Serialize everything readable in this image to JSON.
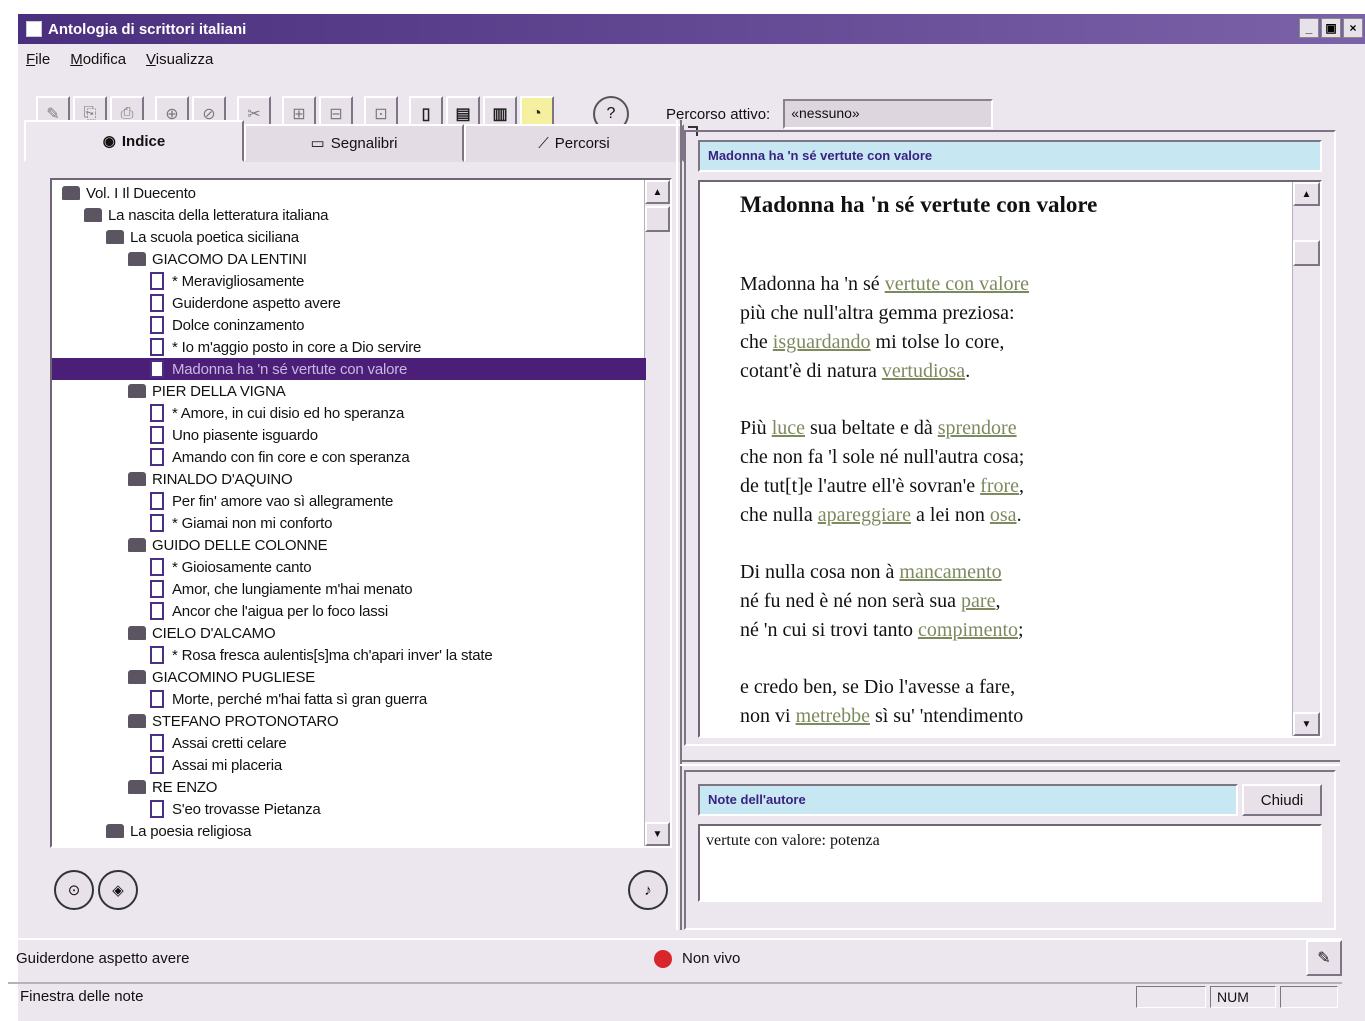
{
  "window": {
    "title": "Antologia di scrittori italiani",
    "buttons": [
      "_",
      "▣",
      "×"
    ]
  },
  "menu": [
    "File",
    "Modifica",
    "Visualizza"
  ],
  "toolbar": {
    "buttons": [
      "✎",
      "⎘",
      "⎙",
      "⊕",
      "⊘",
      "✂",
      "⊞",
      "⊟",
      "⊡",
      "⊠",
      "▯",
      "▤",
      "▥",
      "◔"
    ],
    "path_label": "Percorso attivo:",
    "path_value": "«nessuno»"
  },
  "tabs": [
    {
      "label": "Indice",
      "icon": "index-icon"
    },
    {
      "label": "Segnalibri",
      "icon": "bookmark-icon"
    },
    {
      "label": "Percorsi",
      "icon": "path-icon"
    }
  ],
  "tree": [
    {
      "label": "Vol. I Il Duecento",
      "level": 0,
      "type": "book"
    },
    {
      "label": "La nascita della letteratura italiana",
      "level": 1,
      "type": "book"
    },
    {
      "label": "La scuola poetica siciliana",
      "level": 2,
      "type": "book"
    },
    {
      "label": "GIACOMO DA LENTINI",
      "level": 3,
      "type": "book"
    },
    {
      "label": "* Meravigliosamente",
      "level": 4,
      "type": "doc"
    },
    {
      "label": "Guiderdone aspetto avere",
      "level": 4,
      "type": "doc"
    },
    {
      "label": "Dolce coninzamento",
      "level": 4,
      "type": "doc"
    },
    {
      "label": "* Io m'aggio posto in core a Dio servire",
      "level": 4,
      "type": "doc"
    },
    {
      "label": "Madonna ha 'n sé vertute con valore",
      "level": 4,
      "type": "doc",
      "selected": true
    },
    {
      "label": "PIER DELLA VIGNA",
      "level": 3,
      "type": "book"
    },
    {
      "label": "* Amore, in cui disio ed ho speranza",
      "level": 4,
      "type": "doc"
    },
    {
      "label": "Uno piasente isguardo",
      "level": 4,
      "type": "doc"
    },
    {
      "label": "Amando con fin core e con speranza",
      "level": 4,
      "type": "doc"
    },
    {
      "label": "RINALDO D'AQUINO",
      "level": 3,
      "type": "book"
    },
    {
      "label": "Per fin' amore vao sì allegramente",
      "level": 4,
      "type": "doc"
    },
    {
      "label": "* Giamai non mi conforto",
      "level": 4,
      "type": "doc"
    },
    {
      "label": "GUIDO DELLE COLONNE",
      "level": 3,
      "type": "book"
    },
    {
      "label": "* Gioiosamente canto",
      "level": 4,
      "type": "doc"
    },
    {
      "label": "Amor, che lungiamente m'hai menato",
      "level": 4,
      "type": "doc"
    },
    {
      "label": "Ancor che l'aigua per lo foco lassi",
      "level": 4,
      "type": "doc"
    },
    {
      "label": "CIELO D'ALCAMO",
      "level": 3,
      "type": "book"
    },
    {
      "label": "* Rosa fresca aulentis[s]ma ch'apari inver' la state",
      "level": 4,
      "type": "doc"
    },
    {
      "label": "GIACOMINO PUGLIESE",
      "level": 3,
      "type": "book"
    },
    {
      "label": "Morte, perché m'hai fatta sì gran guerra",
      "level": 4,
      "type": "doc"
    },
    {
      "label": "STEFANO PROTONOTARO",
      "level": 3,
      "type": "book"
    },
    {
      "label": "Assai cretti celare",
      "level": 4,
      "type": "doc"
    },
    {
      "label": "Assai mi placeria",
      "level": 4,
      "type": "doc"
    },
    {
      "label": "RE ENZO",
      "level": 3,
      "type": "book"
    },
    {
      "label": "S'eo trovasse Pietanza",
      "level": 4,
      "type": "doc"
    },
    {
      "label": "La poesia religiosa",
      "level": 2,
      "type": "book"
    }
  ],
  "document": {
    "header": "Madonna ha 'n sé vertute con valore",
    "title": "Madonna ha 'n sé vertute con valore",
    "stanzas": [
      [
        "Madonna ha 'n sé |vertute con valore|",
        "più che null'altra gemma preziosa:",
        "che |isguardando| mi tolse lo core,",
        "cotant'è di natura |vertudiosa|."
      ],
      [
        "Più |luce| sua beltate e dà |sprendore|",
        "che non fa 'l sole né null'autra cosa;",
        "de tut[t]e l'autre ell'è sovran'e |frore|,",
        "che nulla |apareggiare| a lei non |osa|."
      ],
      [
        "Di nulla cosa non à |mancamento|",
        "né fu ned è né non serà sua |pare|,",
        "né 'n cui si trovi tanto |compimento|;"
      ],
      [
        "e credo ben, se Dio l'avesse a fare,",
        "non vi |metrebbe| sì su' 'ntendimento"
      ]
    ]
  },
  "notes": {
    "header": "Note dell'autore",
    "close_label": "Chiudi",
    "text": "vertute con valore: potenza"
  },
  "status": {
    "current": "Guiderdone aspetto avere",
    "rec_text": "Non vivo",
    "window_label": "Finestra delle note",
    "num": "NUM"
  }
}
